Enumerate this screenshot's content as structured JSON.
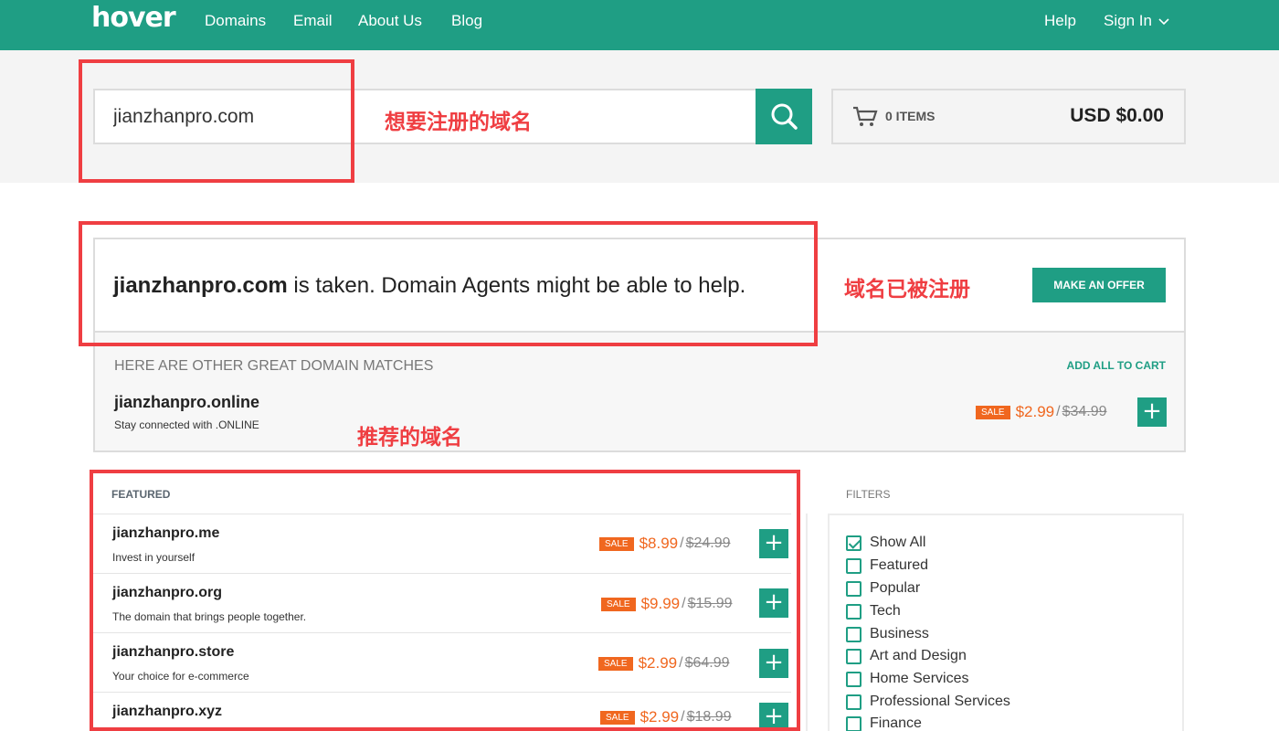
{
  "header": {
    "logo": "hover",
    "nav": [
      "Domains",
      "Email",
      "About Us",
      "Blog"
    ],
    "help": "Help",
    "sign_in": "Sign In"
  },
  "search": {
    "value": "jianzhanpro.com"
  },
  "cart": {
    "items": "0 ITEMS",
    "total": "USD $0.00"
  },
  "taken": {
    "domain": "jianzhanpro.com",
    "message": " is taken. Domain Agents might be able to help.",
    "offer_button": "MAKE AN OFFER"
  },
  "other": {
    "heading": "HERE ARE OTHER GREAT DOMAIN MATCHES",
    "add_all": "ADD ALL TO CART",
    "item": {
      "domain": "jianzhanpro.online",
      "tagline": "Stay connected with .ONLINE",
      "sale": "SALE",
      "price": "$2.99",
      "slash": "/",
      "old_price": "$34.99",
      "add": "+"
    }
  },
  "featured": {
    "label": "FEATURED",
    "items": [
      {
        "domain": "jianzhanpro.me",
        "tagline": "Invest in yourself",
        "sale": "SALE",
        "price": "$8.99",
        "slash": "/",
        "old_price": "$24.99",
        "add": "+"
      },
      {
        "domain": "jianzhanpro.org",
        "tagline": "The domain that brings people together.",
        "sale": "SALE",
        "price": "$9.99",
        "slash": "/",
        "old_price": "$15.99",
        "add": "+"
      },
      {
        "domain": "jianzhanpro.store",
        "tagline": "Your choice for e-commerce",
        "sale": "SALE",
        "price": "$2.99",
        "slash": "/",
        "old_price": "$64.99",
        "add": "+"
      },
      {
        "domain": "jianzhanpro.xyz",
        "tagline": "",
        "sale": "SALE",
        "price": "$2.99",
        "slash": "/",
        "old_price": "$18.99",
        "add": "+"
      }
    ]
  },
  "filters": {
    "label": "FILTERS",
    "items": [
      {
        "label": "Show All",
        "checked": true
      },
      {
        "label": "Featured",
        "checked": false
      },
      {
        "label": "Popular",
        "checked": false
      },
      {
        "label": "Tech",
        "checked": false
      },
      {
        "label": "Business",
        "checked": false
      },
      {
        "label": "Art and Design",
        "checked": false
      },
      {
        "label": "Home Services",
        "checked": false
      },
      {
        "label": "Professional Services",
        "checked": false
      },
      {
        "label": "Finance",
        "checked": false
      }
    ]
  },
  "annotations": {
    "want_register": "想要注册的域名",
    "already_registered": "域名已被注册",
    "recommended": "推荐的域名"
  },
  "colors": {
    "brand": "#1f9e84",
    "sale": "#f0671f",
    "annotation": "#ef3e42"
  }
}
